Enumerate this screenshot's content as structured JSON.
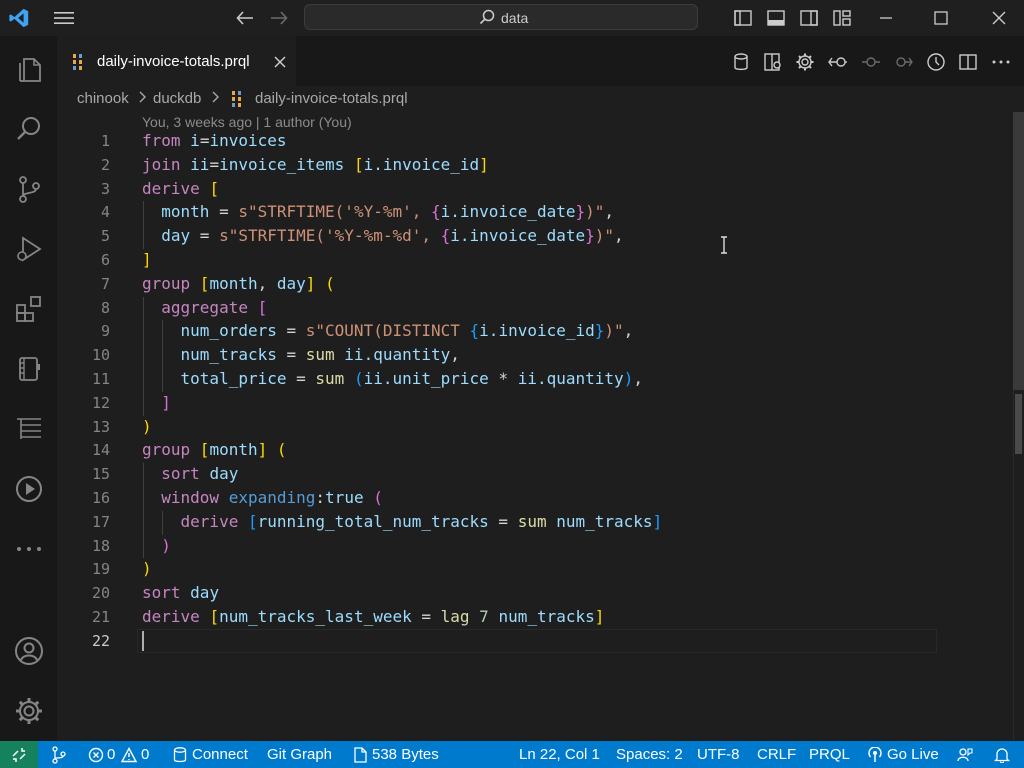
{
  "titlebar": {
    "search_text": "data",
    "icons": [
      "vscode-logo",
      "menu-icon",
      "back-arrow-icon",
      "forward-arrow-icon",
      "search-icon",
      "toggle-primary-sidebar-icon",
      "toggle-panel-icon",
      "toggle-secondary-sidebar-icon",
      "customize-layout-icon",
      "minimize-icon",
      "maximize-icon",
      "close-icon"
    ]
  },
  "activitybar": [
    "explorer-icon",
    "search-icon",
    "source-control-icon",
    "run-debug-icon",
    "extensions-icon",
    "notebook-icon",
    "test-tree-icon",
    "play-icon",
    "more-icon",
    "account-icon",
    "manage-gear-icon"
  ],
  "tab": {
    "label": "daily-invoice-totals.prql"
  },
  "breadcrumb": {
    "root": "chinook",
    "folder": "duckdb",
    "file": "daily-invoice-totals.prql"
  },
  "blame": "You, 3 weeks ago | 1 author (You)",
  "code": {
    "lines": [
      [
        [
          "kw",
          "from "
        ],
        [
          "id",
          "i"
        ],
        [
          "op",
          "="
        ],
        [
          "id",
          "invoices"
        ]
      ],
      [
        [
          "kw",
          "join "
        ],
        [
          "id",
          "ii"
        ],
        [
          "op",
          "="
        ],
        [
          "id",
          "invoice_items "
        ],
        [
          "br1",
          "["
        ],
        [
          "id",
          "i.invoice_id"
        ],
        [
          "br1",
          "]"
        ]
      ],
      [
        [
          "kw",
          "derive "
        ],
        [
          "br1",
          "["
        ]
      ],
      [
        [
          "op",
          "  "
        ],
        [
          "id",
          "month"
        ],
        [
          "op",
          " = "
        ],
        [
          "st",
          "s\"STRFTIME('%Y-%m', "
        ],
        [
          "br2",
          "{"
        ],
        [
          "id",
          "i.invoice_date"
        ],
        [
          "br2",
          "}"
        ],
        [
          "st",
          ")\""
        ],
        [
          "op",
          ","
        ]
      ],
      [
        [
          "op",
          "  "
        ],
        [
          "id",
          "day"
        ],
        [
          "op",
          " = "
        ],
        [
          "st",
          "s\"STRFTIME('%Y-%m-%d', "
        ],
        [
          "br2",
          "{"
        ],
        [
          "id",
          "i.invoice_date"
        ],
        [
          "br2",
          "}"
        ],
        [
          "st",
          ")\""
        ],
        [
          "op",
          ","
        ]
      ],
      [
        [
          "br1",
          "]"
        ]
      ],
      [
        [
          "kw",
          "group "
        ],
        [
          "br1",
          "["
        ],
        [
          "id",
          "month"
        ],
        [
          "op",
          ", "
        ],
        [
          "id",
          "day"
        ],
        [
          "br1",
          "]"
        ],
        [
          "op",
          " "
        ],
        [
          "br1",
          "("
        ]
      ],
      [
        [
          "op",
          "  "
        ],
        [
          "kw",
          "aggregate "
        ],
        [
          "br2",
          "["
        ]
      ],
      [
        [
          "op",
          "    "
        ],
        [
          "id",
          "num_orders"
        ],
        [
          "op",
          " = "
        ],
        [
          "st",
          "s\"COUNT(DISTINCT "
        ],
        [
          "br3",
          "{"
        ],
        [
          "id",
          "i.invoice_id"
        ],
        [
          "br3",
          "}"
        ],
        [
          "st",
          ")\""
        ],
        [
          "op",
          ","
        ]
      ],
      [
        [
          "op",
          "    "
        ],
        [
          "id",
          "num_tracks"
        ],
        [
          "op",
          " = "
        ],
        [
          "fn",
          "sum "
        ],
        [
          "id",
          "ii.quantity"
        ],
        [
          "op",
          ","
        ]
      ],
      [
        [
          "op",
          "    "
        ],
        [
          "id",
          "total_price"
        ],
        [
          "op",
          " = "
        ],
        [
          "fn",
          "sum "
        ],
        [
          "br3",
          "("
        ],
        [
          "id",
          "ii.unit_price"
        ],
        [
          "op",
          " * "
        ],
        [
          "id",
          "ii.quantity"
        ],
        [
          "br3",
          ")"
        ],
        [
          "op",
          ","
        ]
      ],
      [
        [
          "op",
          "  "
        ],
        [
          "br2",
          "]"
        ]
      ],
      [
        [
          "br1",
          ")"
        ]
      ],
      [
        [
          "kw",
          "group "
        ],
        [
          "br1",
          "["
        ],
        [
          "id",
          "month"
        ],
        [
          "br1",
          "]"
        ],
        [
          "op",
          " "
        ],
        [
          "br1",
          "("
        ]
      ],
      [
        [
          "op",
          "  "
        ],
        [
          "kw",
          "sort "
        ],
        [
          "id",
          "day"
        ]
      ],
      [
        [
          "op",
          "  "
        ],
        [
          "kw",
          "window "
        ],
        [
          "pl",
          "expanding"
        ],
        [
          "op",
          ":"
        ],
        [
          "id",
          "true"
        ],
        [
          "op",
          " "
        ],
        [
          "br2",
          "("
        ]
      ],
      [
        [
          "op",
          "    "
        ],
        [
          "kw",
          "derive "
        ],
        [
          "br3",
          "["
        ],
        [
          "id",
          "running_total_num_tracks"
        ],
        [
          "op",
          " = "
        ],
        [
          "fn",
          "sum "
        ],
        [
          "id",
          "num_tracks"
        ],
        [
          "br3",
          "]"
        ]
      ],
      [
        [
          "op",
          "  "
        ],
        [
          "br2",
          ")"
        ]
      ],
      [
        [
          "br1",
          ")"
        ]
      ],
      [
        [
          "kw",
          "sort "
        ],
        [
          "id",
          "day"
        ]
      ],
      [
        [
          "kw",
          "derive "
        ],
        [
          "br1",
          "["
        ],
        [
          "id",
          "num_tracks_last_week"
        ],
        [
          "op",
          " = "
        ],
        [
          "fn",
          "lag "
        ],
        [
          "nu",
          "7 "
        ],
        [
          "id",
          "num_tracks"
        ],
        [
          "br1",
          "]"
        ]
      ],
      []
    ]
  },
  "status": {
    "errors": "0",
    "warnings": "0",
    "connect": "Connect",
    "git_graph": "Git Graph",
    "file_size": "538 Bytes",
    "cursor": "Ln 22, Col 1",
    "spaces": "Spaces: 2",
    "encoding": "UTF-8",
    "eol": "CRLF",
    "language": "PRQL",
    "go_live": "Go Live"
  },
  "colors": {
    "accent": "#007acc",
    "keyword": "#c586c0",
    "identifier": "#9cdcfe",
    "string": "#ce9178",
    "bracket1": "#ffd700",
    "bracket2": "#da70d6",
    "bracket3": "#179fff"
  }
}
